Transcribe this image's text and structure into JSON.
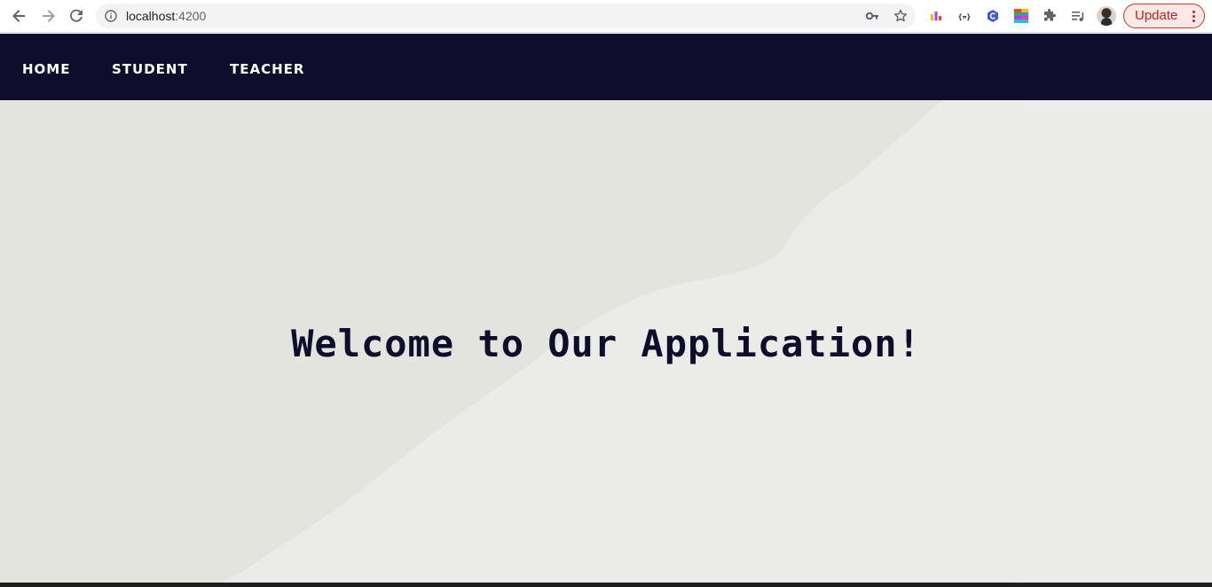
{
  "browser": {
    "url_host": "localhost",
    "url_port": ":4200",
    "update_label": "Update",
    "icons": [
      "back-icon",
      "forward-icon",
      "reload-icon",
      "info-icon",
      "key-icon",
      "star-icon",
      "extensions-icon",
      "media-icon",
      "profile-avatar",
      "menu-icon"
    ]
  },
  "nav": {
    "items": [
      {
        "label": "HOME"
      },
      {
        "label": "STUDENT"
      },
      {
        "label": "TEACHER"
      }
    ]
  },
  "hero": {
    "title": "Welcome to Our Application!"
  },
  "colors": {
    "nav_bg": "#0e0e2c",
    "hero_bg": "#e6e7e1",
    "title": "#0e0e2c",
    "update_accent": "#c5221f"
  }
}
